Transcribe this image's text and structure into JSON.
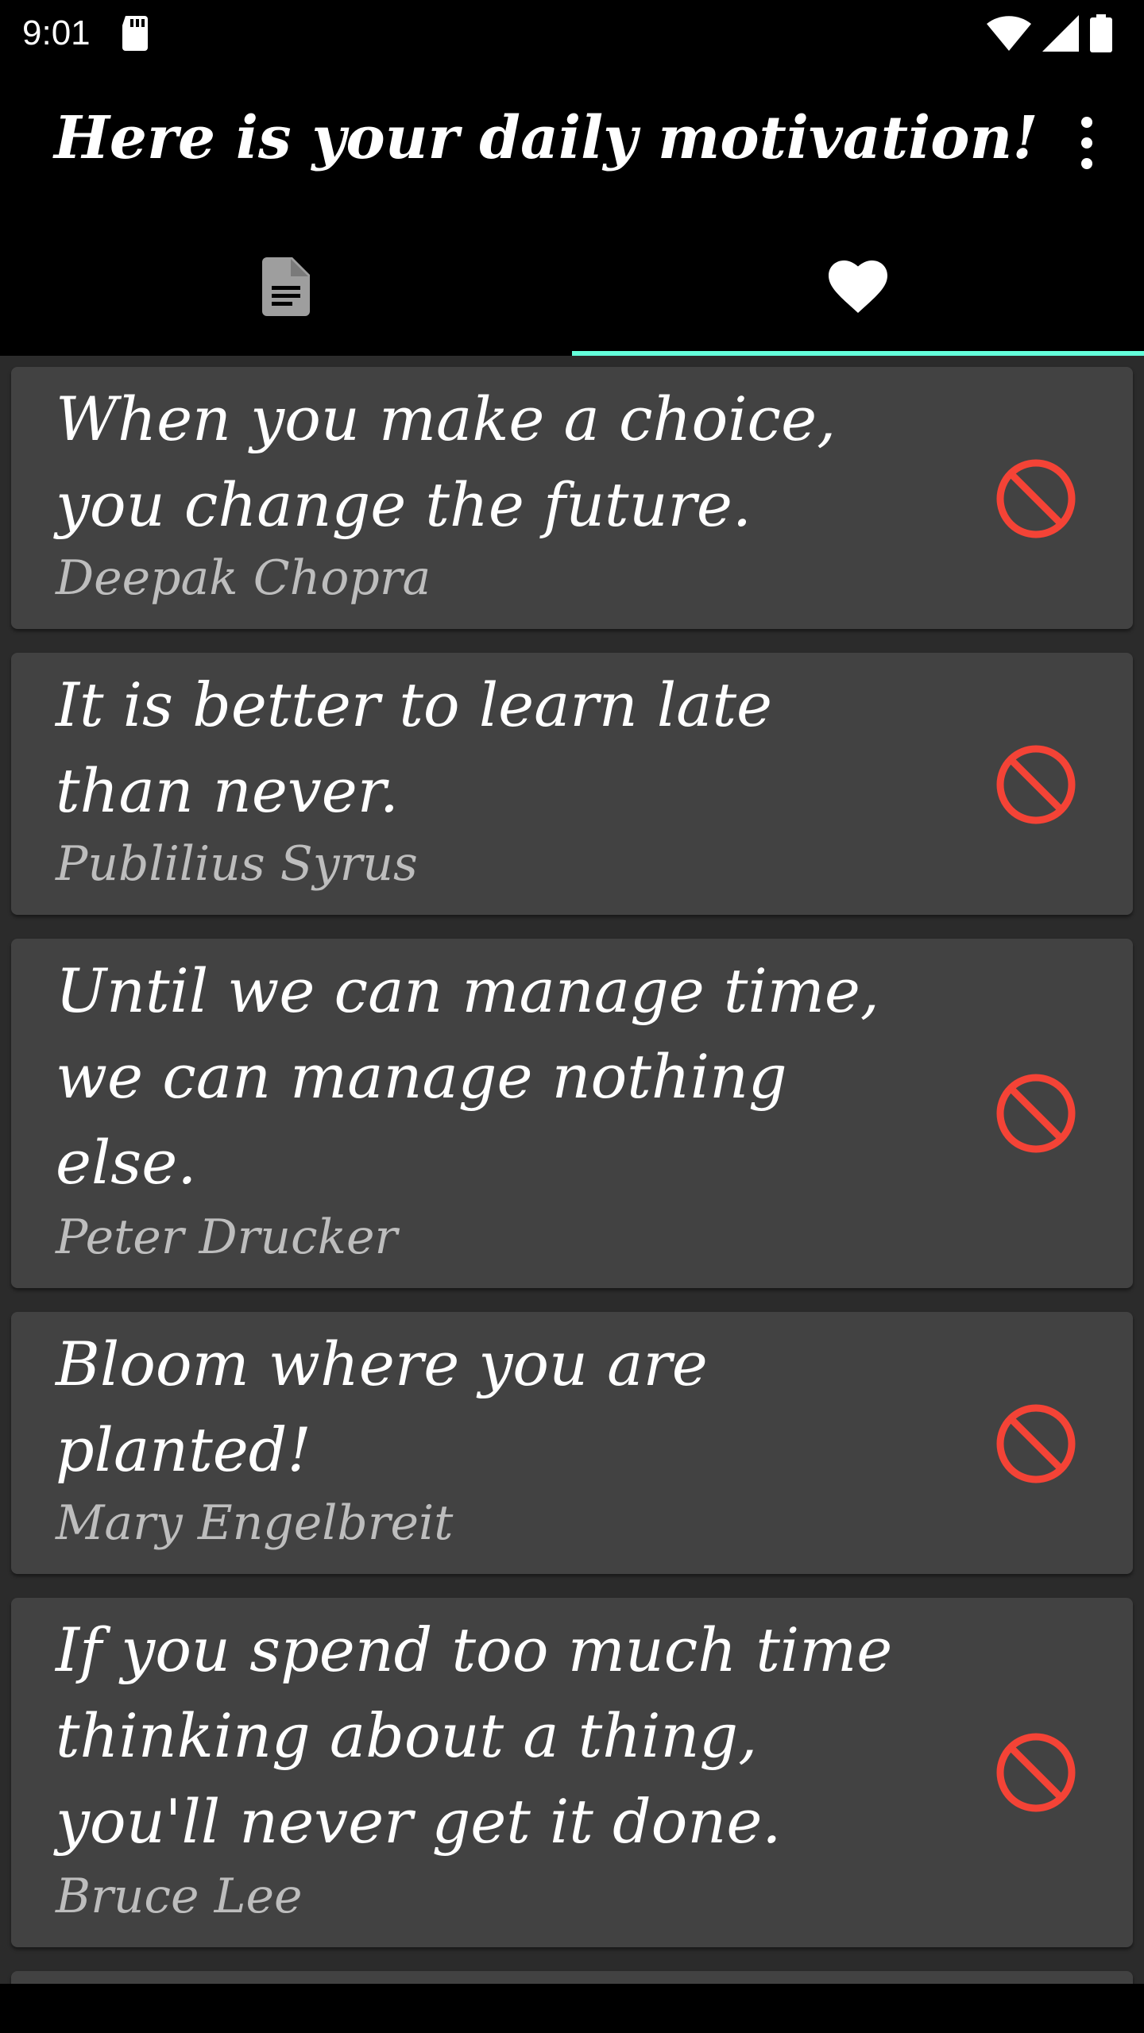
{
  "status_bar": {
    "time": "9:01",
    "icons": [
      "sd-card-icon",
      "wifi-icon",
      "cell-signal-icon",
      "battery-icon"
    ]
  },
  "app_bar": {
    "title": "Here is your daily motivation!",
    "overflow_icon": "more-vert-icon"
  },
  "tabs": [
    {
      "icon": "document-icon",
      "selected": false
    },
    {
      "icon": "heart-icon",
      "selected": true
    }
  ],
  "colors": {
    "background": "#2b2b2b",
    "bar": "#000000",
    "card": "#424242",
    "tab_indicator": "#64ffda",
    "remove_icon": "#f44336",
    "quote_text": "#ffffff",
    "author_text": "#bdbdbd"
  },
  "quotes": [
    {
      "text": "When you make a choice, you change the future.",
      "author": "Deepak Chopra",
      "action_icon": "block-icon"
    },
    {
      "text": "It is better to learn late than never.",
      "author": "Publilius Syrus",
      "action_icon": "block-icon"
    },
    {
      "text": "Until we can manage time, we can manage nothing else.",
      "author": "Peter Drucker",
      "action_icon": "block-icon"
    },
    {
      "text": "Bloom where you are planted!",
      "author": "Mary Engelbreit",
      "action_icon": "block-icon"
    },
    {
      "text": "If you spend too much time thinking about a thing, you'll never get it done.",
      "author": "Bruce Lee",
      "action_icon": "block-icon"
    }
  ]
}
